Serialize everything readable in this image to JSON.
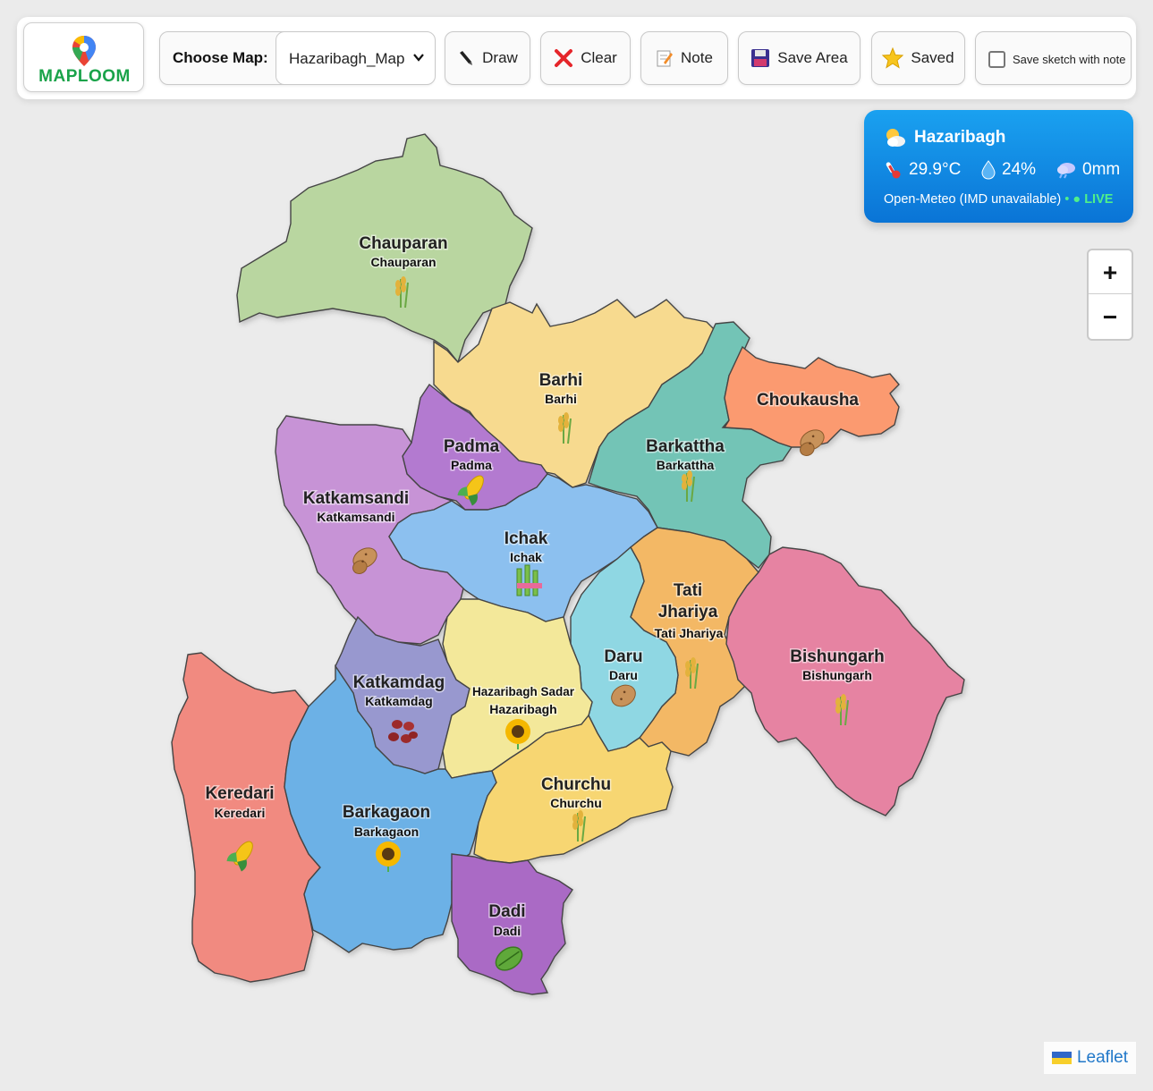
{
  "app": {
    "logo_text": "MAPLOOM"
  },
  "toolbar": {
    "choose_label": "Choose Map:",
    "map_select_value": "Hazaribagh_Map",
    "draw_label": "Draw",
    "clear_label": "Clear",
    "note_label": "Note",
    "save_area_label": "Save Area",
    "saved_label": "Saved",
    "save_sketch_label": "Save sketch with note",
    "save_sketch_checked": false
  },
  "weather": {
    "location": "Hazaribagh",
    "temperature": "29.9°C",
    "humidity": "24%",
    "rain": "0mm",
    "source": "Open-Meteo (IMD unavailable)",
    "live_label": "LIVE"
  },
  "zoom": {
    "in_label": "+",
    "out_label": "−"
  },
  "attribution": {
    "label": "Leaflet"
  },
  "regions": [
    {
      "name": "Chauparan",
      "sub": "Chauparan",
      "crop": "wheat",
      "color": "#b9d6a0"
    },
    {
      "name": "Barhi",
      "sub": "Barhi",
      "crop": "wheat",
      "color": "#f7da8f"
    },
    {
      "name": "Padma",
      "sub": "Padma",
      "crop": "corn",
      "color": "#b37ad0"
    },
    {
      "name": "Katkamsandi",
      "sub": "Katkamsandi",
      "crop": "potato",
      "color": "#c793d6"
    },
    {
      "name": "Barkattha",
      "sub": "Barkattha",
      "crop": "wheat",
      "color": "#73c4b6"
    },
    {
      "name": "Choukausha",
      "sub": "",
      "crop": "potato",
      "color": "#fb9a70"
    },
    {
      "name": "Ichak",
      "sub": "Ichak",
      "crop": "sugarcane",
      "color": "#8cc0ef"
    },
    {
      "name": "Tati Jhariya",
      "sub": "Tati Jhariya",
      "crop": "none",
      "color": "#f3b865"
    },
    {
      "name": "Daru",
      "sub": "Daru",
      "crop": "potato",
      "color": "#8fd7e3"
    },
    {
      "name": "Bishungarh",
      "sub": "Bishungarh",
      "crop": "wheat",
      "color": "#e683a2"
    },
    {
      "name": "Katkamdag",
      "sub": "Katkamdag",
      "crop": "beans",
      "color": "#9898cf"
    },
    {
      "name": "Hazaribagh Sadar",
      "sub": "Hazaribagh",
      "crop": "sunflower",
      "color": "#f3e89a"
    },
    {
      "name": "Keredari",
      "sub": "Keredari",
      "crop": "corn",
      "color": "#f18a80"
    },
    {
      "name": "Barkagaon",
      "sub": "Barkagaon",
      "crop": "sunflower",
      "color": "#6cb1e6"
    },
    {
      "name": "Churchu",
      "sub": "Churchu",
      "crop": "wheat",
      "color": "#f7d672"
    },
    {
      "name": "Dadi",
      "sub": "Dadi",
      "crop": "leaf",
      "color": "#aa6bc5"
    }
  ]
}
